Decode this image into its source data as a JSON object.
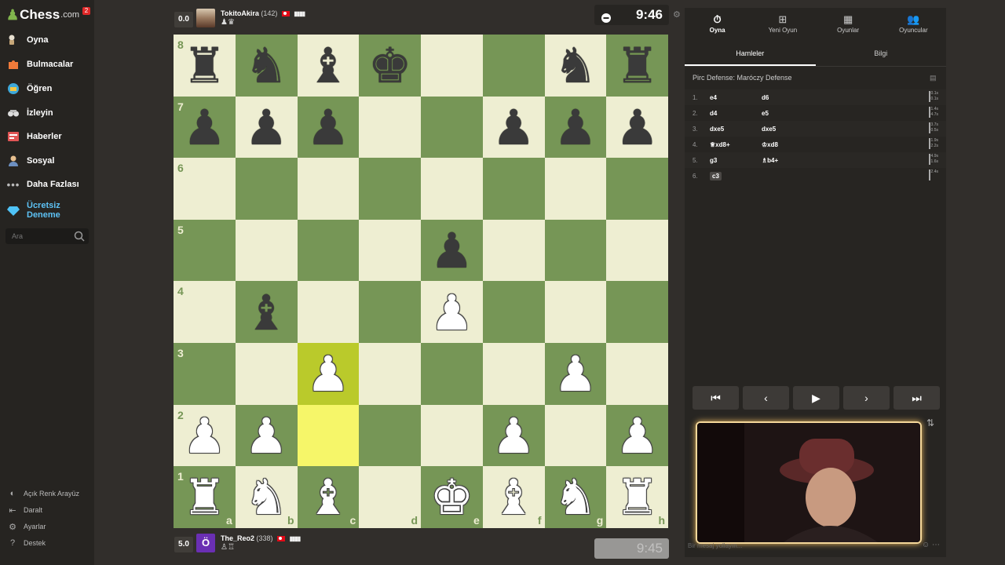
{
  "app": {
    "logo_text": "Chess",
    "logo_suffix": ".com",
    "notification_count": "2"
  },
  "sidebar": {
    "items": [
      {
        "label": "Oyna",
        "icon": "play-icon"
      },
      {
        "label": "Bulmacalar",
        "icon": "puzzle-icon"
      },
      {
        "label": "Öğren",
        "icon": "learn-icon"
      },
      {
        "label": "İzleyin",
        "icon": "watch-icon"
      },
      {
        "label": "Haberler",
        "icon": "news-icon"
      },
      {
        "label": "Sosyal",
        "icon": "social-icon"
      },
      {
        "label": "Daha Fazlası",
        "icon": "more-icon"
      }
    ],
    "promo": {
      "line1": "Ücretsiz",
      "line2": "Deneme"
    },
    "search_placeholder": "Ara",
    "bottom": [
      {
        "label": "Açık Renk Arayüz",
        "icon": "theme-icon"
      },
      {
        "label": "Daralt",
        "icon": "collapse-icon"
      },
      {
        "label": "Ayarlar",
        "icon": "settings-icon"
      },
      {
        "label": "Destek",
        "icon": "help-icon"
      }
    ]
  },
  "top_player": {
    "score": "0.0",
    "name": "TokitoAkira",
    "rating": "(142)",
    "captured": "♟♛",
    "clock": "9:46"
  },
  "bottom_player": {
    "score": "5.0",
    "name": "The_Reo2",
    "rating": "(338)",
    "avatar_letter": "Ö",
    "captured": "♙♖",
    "clock": "9:45"
  },
  "board": {
    "ranks": [
      "8",
      "7",
      "6",
      "5",
      "4",
      "3",
      "2",
      "1"
    ],
    "files": [
      "a",
      "b",
      "c",
      "d",
      "e",
      "f",
      "g",
      "h"
    ],
    "squares": [
      [
        "bR",
        "bN",
        "bB",
        "bK",
        "",
        "",
        "bN",
        "bR"
      ],
      [
        "bP",
        "bP",
        "bP",
        "",
        "",
        "bP",
        "bP",
        "bP"
      ],
      [
        "",
        "",
        "",
        "",
        "",
        "",
        "",
        ""
      ],
      [
        "",
        "",
        "",
        "",
        "bP",
        "",
        "",
        ""
      ],
      [
        "",
        "bB",
        "",
        "",
        "wP",
        "",
        "",
        ""
      ],
      [
        "",
        "",
        "wP",
        "",
        "",
        "",
        "wP",
        ""
      ],
      [
        "wP",
        "wP",
        "",
        "",
        "",
        "wP",
        "",
        "wP"
      ],
      [
        "wR",
        "wN",
        "wB",
        "",
        "wK",
        "wB",
        "wN",
        "wR"
      ]
    ],
    "highlights": [
      "c3",
      "c2"
    ]
  },
  "right_panel": {
    "nav": [
      {
        "label": "Oyna",
        "icon": "stopwatch-icon"
      },
      {
        "label": "Yeni Oyun",
        "icon": "plus-icon"
      },
      {
        "label": "Oyunlar",
        "icon": "board-icon"
      },
      {
        "label": "Oyuncular",
        "icon": "players-icon"
      }
    ],
    "tabs": [
      "Hamleler",
      "Bilgi"
    ],
    "opening": "Pirc Defense: Maróczy Defense",
    "moves": [
      {
        "n": "1.",
        "w": "e4",
        "b": "d6",
        "t1": "0.1s",
        "t2": "0.1s"
      },
      {
        "n": "2.",
        "w": "d4",
        "b": "e5",
        "t1": "1.4s",
        "t2": "4.7s"
      },
      {
        "n": "3.",
        "w": "dxe5",
        "b": "dxe5",
        "t1": "3.7s",
        "t2": "0.5s"
      },
      {
        "n": "4.",
        "w": "♕xd8+",
        "b": "♔xd8",
        "t1": "1.9s",
        "t2": "2.2s"
      },
      {
        "n": "5.",
        "w": "g3",
        "b": "♗b4+",
        "t1": "4.9s",
        "t2": "1.6s"
      },
      {
        "n": "6.",
        "w": "c3",
        "b": "",
        "t1": "2.4s",
        "t2": ""
      }
    ],
    "chat_placeholder": "Bir mesaj yollayın..."
  }
}
